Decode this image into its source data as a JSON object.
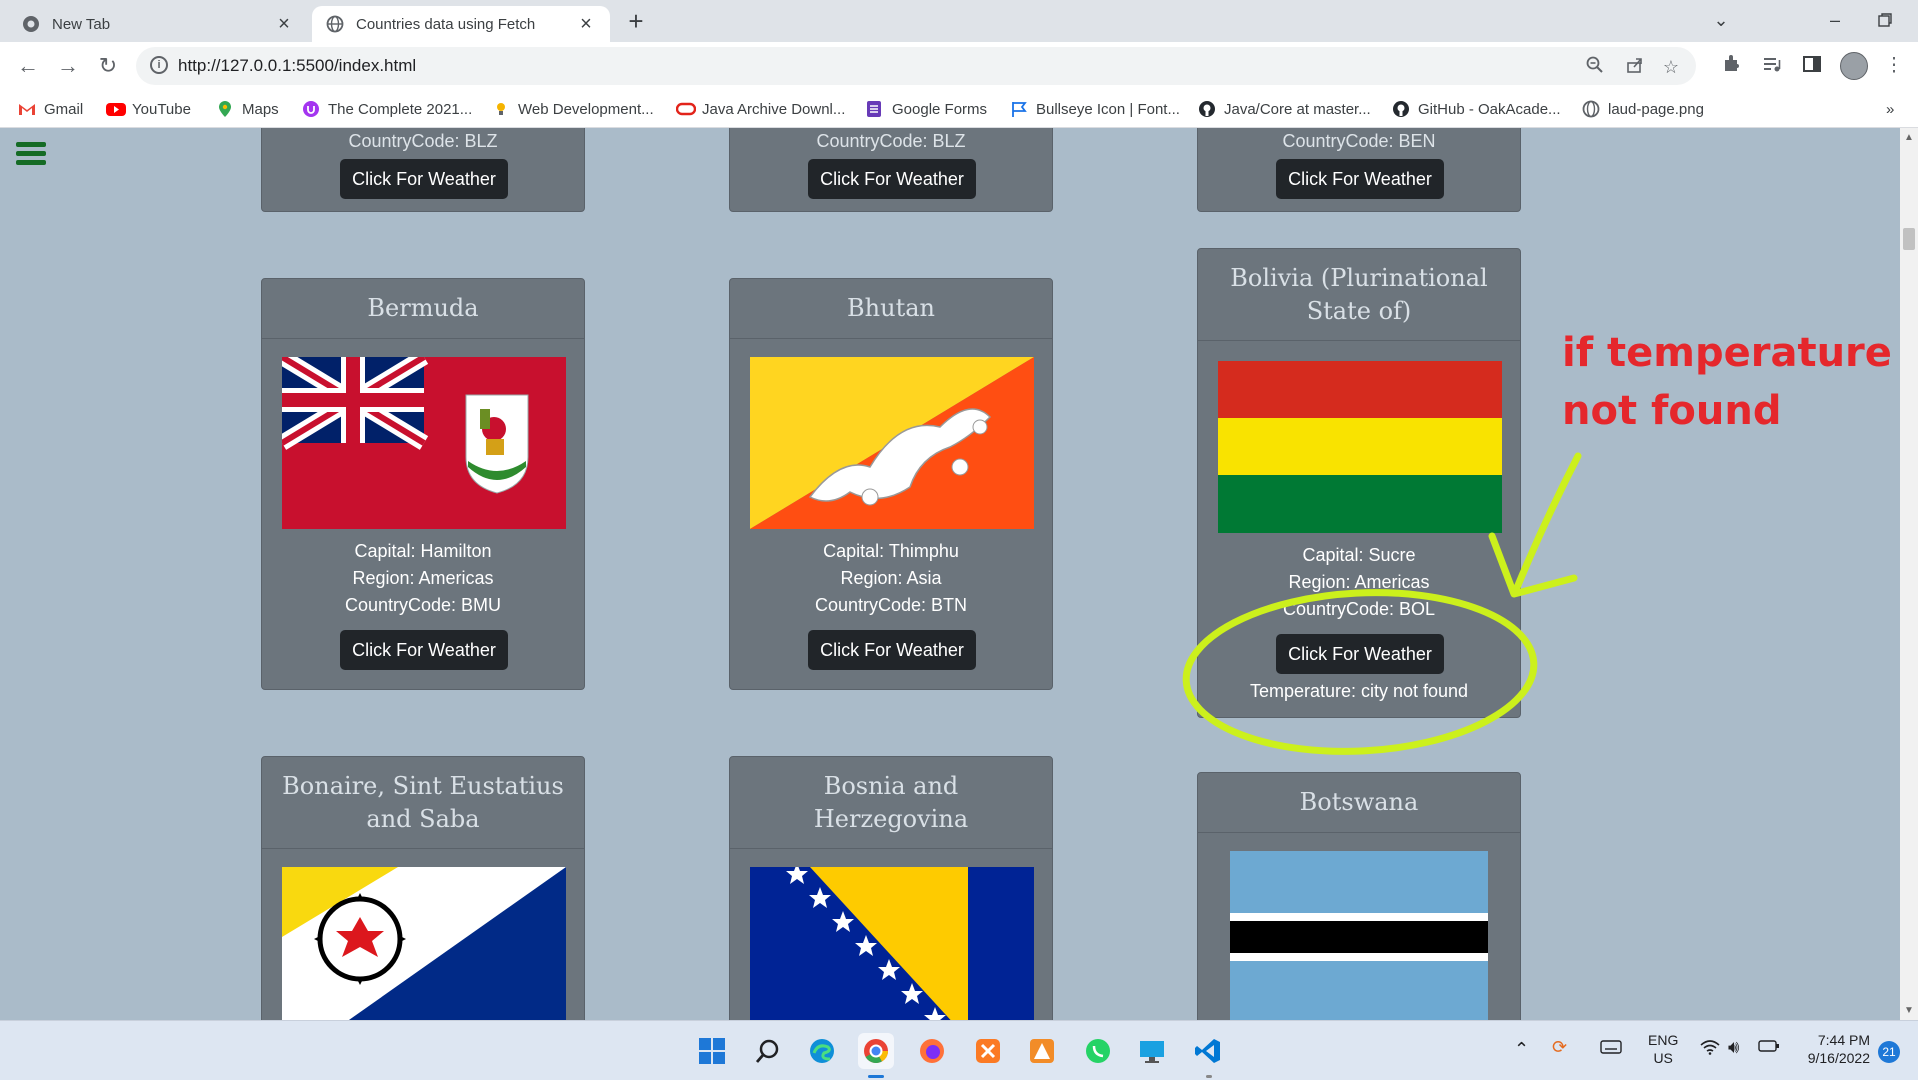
{
  "browser": {
    "tabs": [
      {
        "title": "New Tab",
        "active": false
      },
      {
        "title": "Countries data using Fetch",
        "active": true
      }
    ],
    "url": "http://127.0.0.1:5500/index.html",
    "bookmarks": [
      {
        "label": "Gmail",
        "icon": "gmail-icon"
      },
      {
        "label": "YouTube",
        "icon": "youtube-icon"
      },
      {
        "label": "Maps",
        "icon": "maps-icon"
      },
      {
        "label": "The Complete 2021...",
        "icon": "udemy-icon"
      },
      {
        "label": "Web Development...",
        "icon": "bulb-icon"
      },
      {
        "label": "Java Archive Downl...",
        "icon": "oracle-icon"
      },
      {
        "label": "Google Forms",
        "icon": "forms-icon"
      },
      {
        "label": "Bullseye Icon | Font...",
        "icon": "flag-icon"
      },
      {
        "label": "Java/Core at master...",
        "icon": "github-icon"
      },
      {
        "label": "GitHub - OakAcade...",
        "icon": "github-icon"
      },
      {
        "label": "laud-page.png",
        "icon": "globe-icon"
      }
    ],
    "more_bookmarks": "»"
  },
  "page": {
    "top_row": [
      {
        "code_line": "CountryCode: BLZ",
        "button": "Click For Weather"
      },
      {
        "code_line": "CountryCode: BLZ",
        "button": "Click For Weather"
      },
      {
        "code_line": "CountryCode: BEN",
        "button": "Click For Weather"
      }
    ],
    "cards": [
      {
        "name": "Bermuda",
        "capital": "Capital: Hamilton",
        "region": "Region: Americas",
        "code": "CountryCode: BMU",
        "button": "Click For Weather"
      },
      {
        "name": "Bhutan",
        "capital": "Capital: Thimphu",
        "region": "Region: Asia",
        "code": "CountryCode: BTN",
        "button": "Click For Weather"
      },
      {
        "name": "Bolivia (Plurinational State of)",
        "capital": "Capital: Sucre",
        "region": "Region: Americas",
        "code": "CountryCode: BOL",
        "button": "Click For Weather",
        "temperature": "Temperature: city not found"
      },
      {
        "name": "Bonaire, Sint Eustatius and Saba"
      },
      {
        "name": "Bosnia and Herzegovina"
      },
      {
        "name": "Botswana"
      }
    ]
  },
  "annotation": {
    "text": "if temperature not found",
    "color": "#e5272c",
    "ellipse_color": "#ccf01c"
  },
  "taskbar": {
    "apps": [
      "start-icon",
      "search-icon",
      "edge-icon",
      "chrome-icon",
      "firefox-icon",
      "xampp-icon",
      "app-icon",
      "whatsapp-icon",
      "desktop-icon",
      "vscode-icon"
    ],
    "lang_line1": "ENG",
    "lang_line2": "US",
    "time": "7:44 PM",
    "date": "9/16/2022",
    "notifications": "21"
  }
}
